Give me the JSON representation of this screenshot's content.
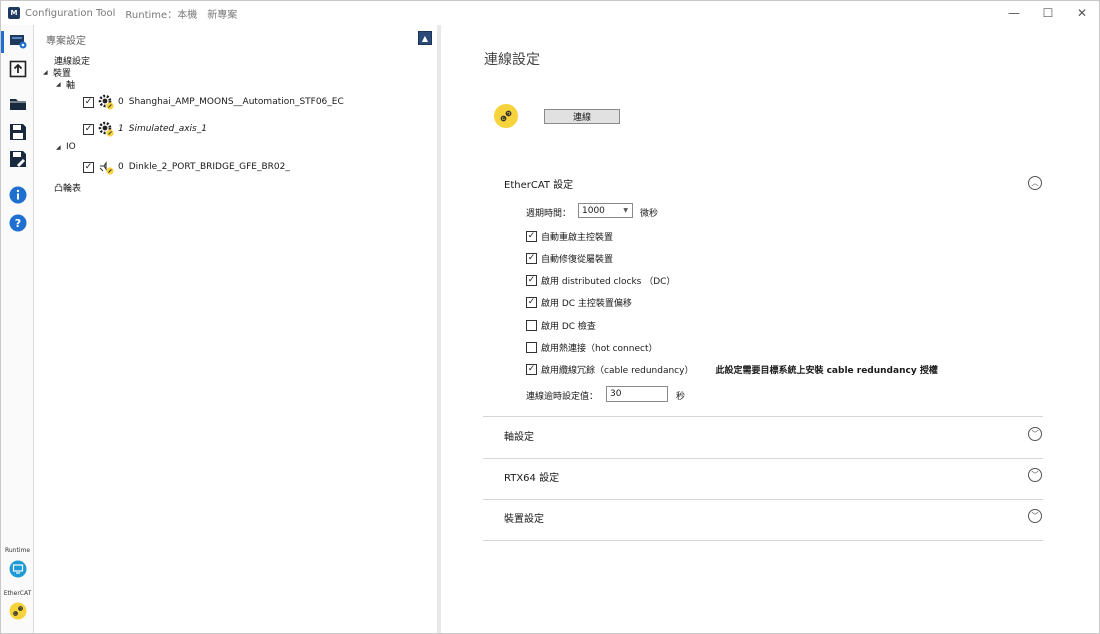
{
  "titlebar": {
    "logo": "M",
    "app_title": "Configuration Tool",
    "runtime_label": "Runtime：本機",
    "project_name": "新專案",
    "minimize": "—",
    "maximize": "☐",
    "close": "✕"
  },
  "rail": {
    "icons": [
      "connection-settings-icon",
      "upload-icon",
      "open-folder-icon",
      "save-icon",
      "save-as-icon",
      "info-icon",
      "help-icon"
    ],
    "runtime_label": "Runtime",
    "ethercat_label": "EtherCAT"
  },
  "tree": {
    "header": "專案設定",
    "pin": "▲",
    "connection_settings": "連線設定",
    "devices": "裝置",
    "axes_group": "軸",
    "axes": [
      {
        "index": "0",
        "name": "Shanghai_AMP_MOONS__Automation_STF06_EC",
        "checked": true,
        "italic": false
      },
      {
        "index": "1",
        "name": "Simulated_axis_1",
        "checked": true,
        "italic": true
      }
    ],
    "io_group": "IO",
    "io": [
      {
        "index": "0",
        "name": "Dinkle_2_PORT_BRIDGE_GFE_BR02_",
        "checked": true
      }
    ],
    "cam_table": "凸輪表"
  },
  "content": {
    "page_title": "連線設定",
    "connect_button": "連線",
    "ethercat": {
      "title": "EtherCAT 設定",
      "cycle_label": "週期時間：",
      "cycle_value": "1000",
      "cycle_unit": "微秒",
      "options": [
        {
          "label": "自動重啟主控裝置",
          "checked": true
        },
        {
          "label": "自動修復從屬裝置",
          "checked": true
        },
        {
          "label": "啟用 distributed clocks （DC）",
          "checked": true
        },
        {
          "label": "啟用 DC 主控裝置偏移",
          "checked": true
        },
        {
          "label": "啟用 DC 檢查",
          "checked": false
        },
        {
          "label": "啟用熱連接（hot connect）",
          "checked": false
        },
        {
          "label": "啟用纜線冗餘（cable redundancy）",
          "checked": true
        }
      ],
      "redundancy_note": "此設定需要目標系統上安裝 cable redundancy 授權",
      "timeout_label": "連線逾時設定值：",
      "timeout_value": "30",
      "timeout_unit": "秒"
    },
    "sections": [
      {
        "title": "軸設定"
      },
      {
        "title": "RTX64 設定"
      },
      {
        "title": "裝置設定"
      }
    ],
    "chevron_up": "︿",
    "chevron_down": "﹀"
  },
  "colors": {
    "accent": "#1f6fd1",
    "link_badge": "#f7d33b",
    "logo_bg": "#1f3a5f"
  }
}
